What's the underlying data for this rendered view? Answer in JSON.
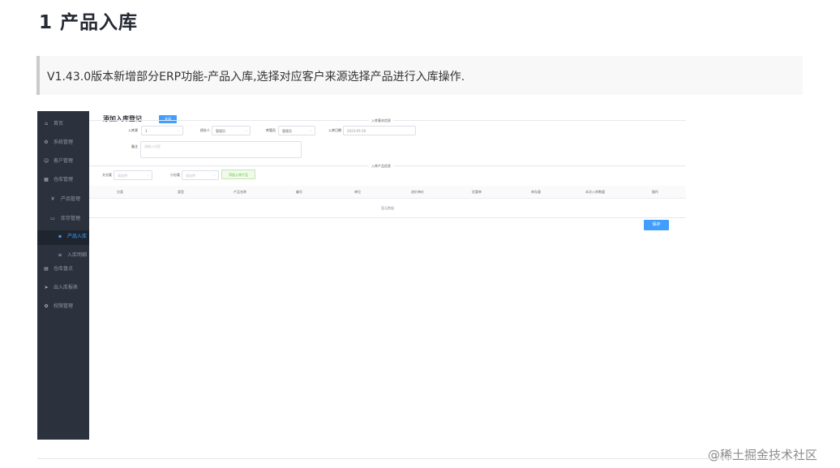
{
  "doc": {
    "title": "1 产品入库",
    "note": "V1.43.0版本新增部分ERP功能-产品入库,选择对应客户来源选择产品进行入库操作."
  },
  "app": {
    "sidebar": [
      {
        "label": "首页",
        "icon": "⌂"
      },
      {
        "label": "系统管理",
        "icon": "⚙"
      },
      {
        "label": "客户管理",
        "icon": "☺"
      },
      {
        "label": "仓库管理",
        "icon": "▦"
      },
      {
        "label": "产品管理",
        "icon": "¥"
      },
      {
        "label": "库存管理",
        "icon": "▭"
      },
      {
        "label": "产品入库",
        "icon": "▪"
      },
      {
        "label": "入库明细",
        "icon": "≡"
      },
      {
        "label": "仓库盘点",
        "icon": "▤"
      },
      {
        "label": "出入库报表",
        "icon": "➤"
      },
      {
        "label": "权限管理",
        "icon": "✿"
      }
    ],
    "page_title": "添加入库登记",
    "close_label": "关闭",
    "section_info": "入库基本信息",
    "section_detail": "入库产品信息",
    "fields": {
      "warehouse_label": "入库源",
      "warehouse_value": "1",
      "handler_label": "经办人",
      "handler_value": "管理员",
      "keeper_label": "库管员",
      "keeper_value": "管理员",
      "date_label": "入库日期",
      "date_value": "2023-05-26",
      "remark_label": "备注",
      "remark_placeholder": "请输入内容",
      "category_label": "大分类",
      "category_placeholder": "请选择",
      "subcategory_label": "小分类",
      "subcategory_placeholder": "请选择"
    },
    "add_product_label": "添加入库产品",
    "table_headers": [
      "分类",
      "类型",
      "产品名称",
      "编号",
      "单位",
      "进价单价",
      "优惠单",
      "库存量",
      "本次入库数量",
      "操作"
    ],
    "empty_text": "暂无数据",
    "save_label": "保存"
  },
  "watermark": "@稀土掘金技术社区",
  "colors": {
    "sidebar": "#2b323d",
    "accent": "#409eff",
    "success": "#67c23a"
  }
}
